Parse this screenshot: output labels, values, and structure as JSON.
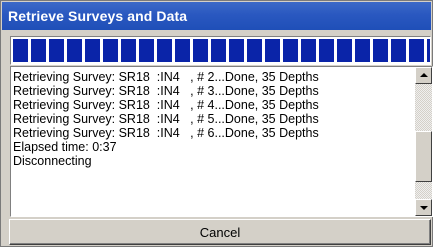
{
  "window": {
    "title": "Retrieve Surveys and Data"
  },
  "progress": {
    "value_percent": 100,
    "block_color": "#0a24a8"
  },
  "log": {
    "lines": [
      "Retrieving Survey: SR18  :IN4   , # 2...Done, 35 Depths",
      "Retrieving Survey: SR18  :IN4   , # 3...Done, 35 Depths",
      "Retrieving Survey: SR18  :IN4   , # 4...Done, 35 Depths",
      "Retrieving Survey: SR18  :IN4   , # 5...Done, 35 Depths",
      "Retrieving Survey: SR18  :IN4   , # 6...Done, 35 Depths",
      "Elapsed time: 0:37",
      "Disconnecting"
    ]
  },
  "buttons": {
    "cancel_label": "Cancel"
  },
  "colors": {
    "title_bar": "#2a58c0",
    "dialog_bg": "#d4d0c8"
  }
}
